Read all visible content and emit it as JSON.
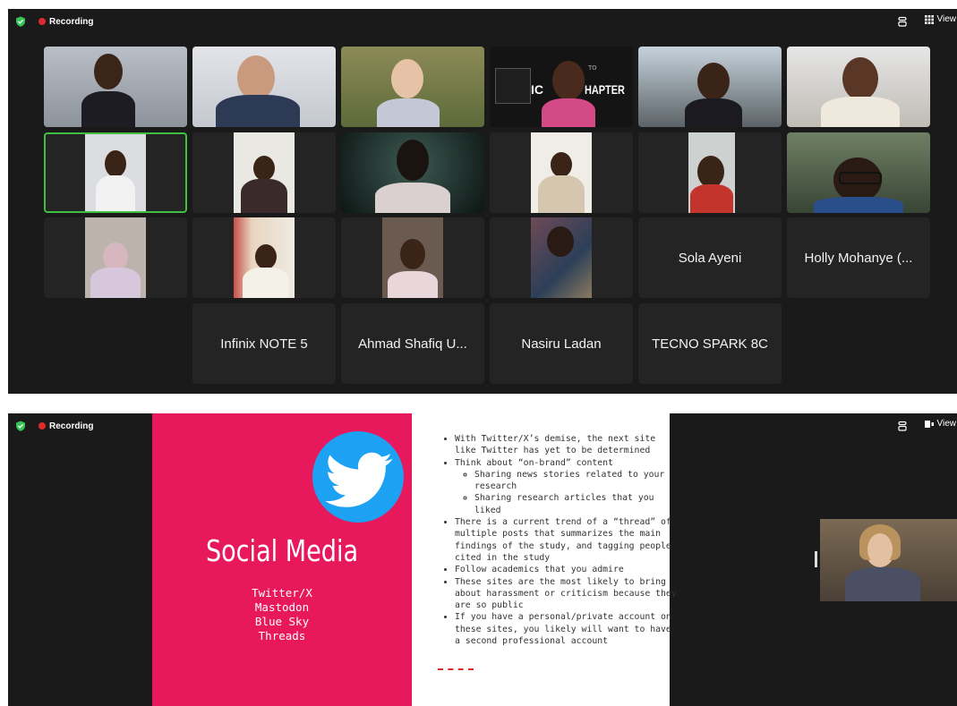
{
  "top_screen": {
    "recording_label": "Recording",
    "view_label": "View",
    "participant_names": [
      "Sola Ayeni",
      "Holly Mohanye (...",
      "Infinix NOTE 5",
      "Ahmad Shafiq U...",
      "Nasiru Ladan",
      "TECNO SPARK 8C"
    ],
    "video_banner": {
      "left": "IC",
      "right": "HAPTER",
      "faint": "TO"
    }
  },
  "bottom_screen": {
    "recording_label": "Recording",
    "view_label": "View",
    "slide": {
      "title": "Social Media",
      "platforms": [
        "Twitter/X",
        "Mastodon",
        "Blue Sky",
        "Threads"
      ],
      "bullets": [
        "With Twitter/X’s demise, the next site like Twitter has yet to be determined",
        "Think about “on-brand” content",
        "There is a current trend of a “thread” of multiple posts that summarizes the main findings of the study, and tagging people cited in the study",
        "Follow academics that you admire",
        "These sites are the most likely to bring about harassment or criticism because they are so public",
        "If you have a personal/private account on these sites, you likely will want to have a second professional account"
      ],
      "sub_bullets": [
        "Sharing news stories related to your research",
        "Sharing research articles that you liked"
      ]
    }
  },
  "colors": {
    "slide_pink": "#e8185c",
    "twitter_blue": "#1da1f2",
    "recording_red": "#e02828",
    "active_speaker_green": "#3fbf3f"
  }
}
